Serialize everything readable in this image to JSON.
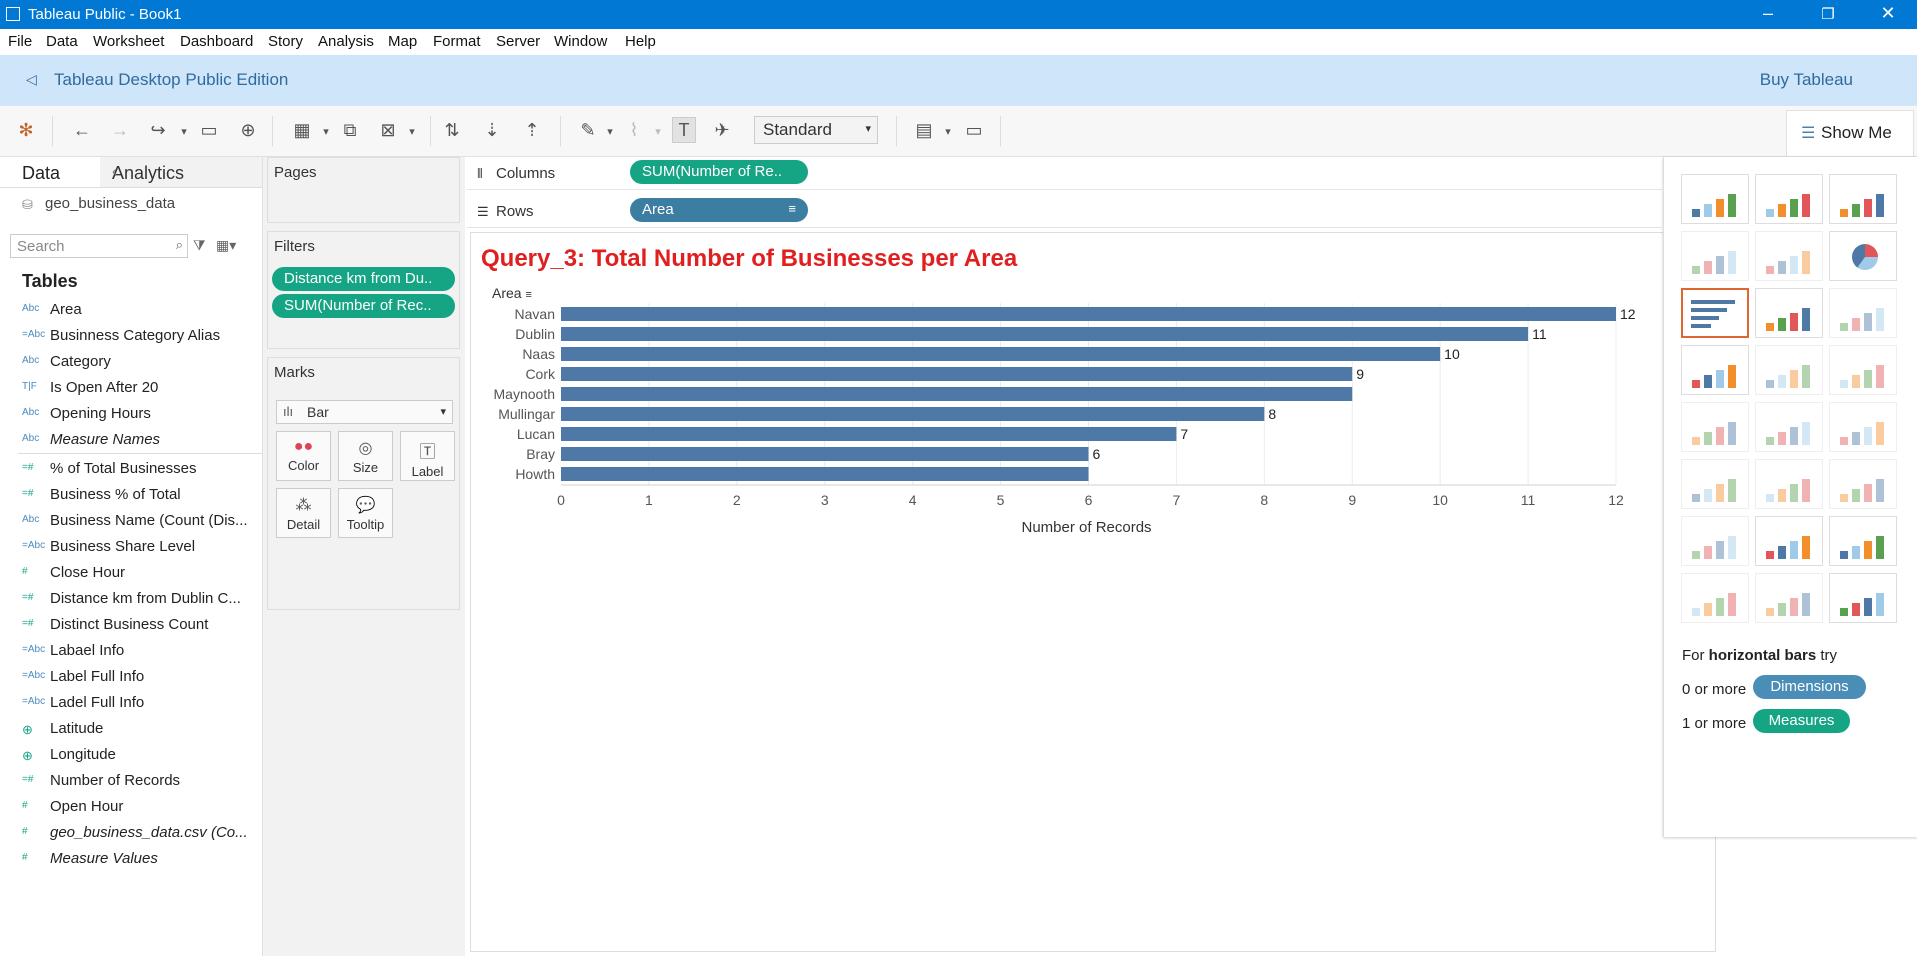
{
  "window": {
    "title": "Tableau Public - Book1"
  },
  "menu": [
    "File",
    "Data",
    "Worksheet",
    "Dashboard",
    "Story",
    "Analysis",
    "Map",
    "Format",
    "Server",
    "Window",
    "Help"
  ],
  "banner": {
    "text": "Tableau Desktop Public Edition",
    "buy": "Buy Tableau"
  },
  "toolbar": {
    "fit": "Standard",
    "show_me": "Show Me"
  },
  "data_pane": {
    "tab_data": "Data",
    "tab_analytics": "Analytics",
    "source": "geo_business_data",
    "search_placeholder": "Search",
    "tables_heading": "Tables",
    "fields": [
      {
        "icon": "Abc",
        "name": "Area",
        "measure": false,
        "italic": false
      },
      {
        "icon": "=Abc",
        "name": "Businness Category Alias",
        "measure": false,
        "italic": false
      },
      {
        "icon": "Abc",
        "name": "Category",
        "measure": false,
        "italic": false
      },
      {
        "icon": "T|F",
        "name": "Is Open After 20",
        "measure": false,
        "italic": false
      },
      {
        "icon": "Abc",
        "name": "Opening Hours",
        "measure": false,
        "italic": false
      },
      {
        "icon": "Abc",
        "name": "Measure Names",
        "measure": false,
        "italic": true
      },
      {
        "icon": "=#",
        "name": "% of Total Businesses",
        "measure": true,
        "italic": false
      },
      {
        "icon": "=#",
        "name": "Business % of Total",
        "measure": true,
        "italic": false
      },
      {
        "icon": "Abc",
        "name": "Business Name (Count (Dis...",
        "measure": false,
        "italic": false
      },
      {
        "icon": "=Abc",
        "name": "Business Share Level",
        "measure": false,
        "italic": false
      },
      {
        "icon": "#",
        "name": "Close Hour",
        "measure": true,
        "italic": false
      },
      {
        "icon": "=#",
        "name": "Distance km from Dublin C...",
        "measure": true,
        "italic": false
      },
      {
        "icon": "=#",
        "name": "Distinct Business Count",
        "measure": true,
        "italic": false
      },
      {
        "icon": "=Abc",
        "name": "Labael Info",
        "measure": false,
        "italic": false
      },
      {
        "icon": "=Abc",
        "name": "Label Full Info",
        "measure": false,
        "italic": false
      },
      {
        "icon": "=Abc",
        "name": "Ladel Full Info",
        "measure": false,
        "italic": false
      },
      {
        "icon": "globe",
        "name": "Latitude",
        "measure": true,
        "italic": false
      },
      {
        "icon": "globe",
        "name": "Longitude",
        "measure": true,
        "italic": false
      },
      {
        "icon": "=#",
        "name": "Number of Records",
        "measure": true,
        "italic": false
      },
      {
        "icon": "#",
        "name": "Open Hour",
        "measure": true,
        "italic": false
      },
      {
        "icon": "#",
        "name": "geo_business_data.csv (Co...",
        "measure": true,
        "italic": true
      },
      {
        "icon": "#",
        "name": "Measure Values",
        "measure": true,
        "italic": true
      }
    ]
  },
  "pages": {
    "heading": "Pages"
  },
  "filters": {
    "heading": "Filters",
    "pills": [
      "Distance km from Du..",
      "SUM(Number of Rec.."
    ]
  },
  "marks": {
    "heading": "Marks",
    "type": "Bar",
    "buttons": [
      "Color",
      "Size",
      "Label",
      "Detail",
      "Tooltip"
    ]
  },
  "shelves": {
    "columns_label": "Columns",
    "columns_pill": "SUM(Number of Re..",
    "rows_label": "Rows",
    "rows_pill": "Area"
  },
  "view": {
    "title": "Query_3: Total Number of Businesses per Area",
    "row_header": "Area"
  },
  "colors": {
    "bar": "#4e79a7",
    "title": "#e02020",
    "dimension_pill": "#3c7ea2",
    "measure_pill": "#15a584",
    "accent": "#0078d4"
  },
  "chart_data": {
    "type": "bar",
    "orientation": "horizontal",
    "title": "Query_3: Total Number of Businesses per Area",
    "categories": [
      "Navan",
      "Dublin",
      "Naas",
      "Cork",
      "Maynooth",
      "Mullingar",
      "Lucan",
      "Bray",
      "Howth"
    ],
    "values": [
      12,
      11,
      10,
      9,
      9,
      8,
      7,
      6,
      6
    ],
    "data_labels": [
      "12",
      "11",
      "10",
      "9",
      "",
      "8",
      "7",
      "6",
      ""
    ],
    "xlabel": "Number of Records",
    "ylabel": "Area",
    "xlim": [
      0,
      12
    ],
    "xticks": [
      0,
      1,
      2,
      3,
      4,
      5,
      6,
      7,
      8,
      9,
      10,
      11,
      12
    ],
    "grid": true
  },
  "show_me": {
    "hint_prefix": "For",
    "hint_chart": "horizontal bars",
    "hint_suffix": "try",
    "dim_prefix": "0 or more",
    "dim_label": "Dimensions",
    "meas_prefix": "1 or more",
    "meas_label": "Measures",
    "thumbnails": [
      "text-table",
      "heat-map",
      "highlight-table",
      "symbol-map",
      "filled-map",
      "pie-chart",
      "horizontal-bars",
      "stacked-bars",
      "side-by-side-bars",
      "treemap",
      "circle-views",
      "side-by-side-circles",
      "lines-continuous",
      "lines-discrete",
      "dual-lines",
      "area-continuous",
      "area-discrete",
      "dual-combination",
      "scatter-plot",
      "histogram",
      "box-and-whisker",
      "gantt-chart",
      "bullet-graph",
      "packed-bubbles"
    ]
  }
}
